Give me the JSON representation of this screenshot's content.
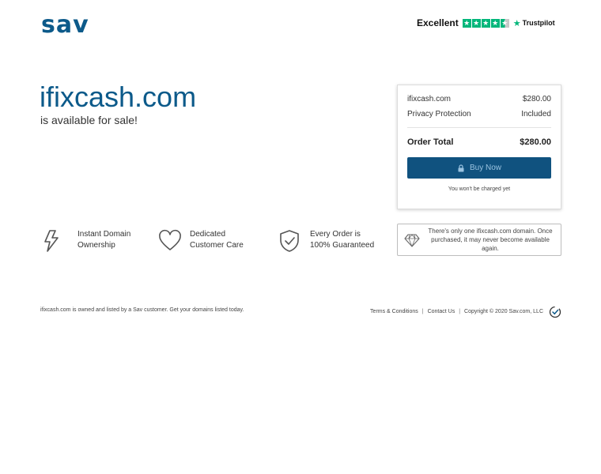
{
  "header": {
    "logo_text": "sav",
    "trust_label": "Excellent",
    "trust_brand": "Trustpilot",
    "trust_color": "#00b67a"
  },
  "hero": {
    "domain": "ifixcash.com",
    "availability": "is available for sale!"
  },
  "order": {
    "items": [
      {
        "label": "ifixcash.com",
        "value": "$280.00"
      },
      {
        "label": "Privacy Protection",
        "value": "Included"
      }
    ],
    "total_label": "Order Total",
    "total_value": "$280.00",
    "buy_label": "Buy Now",
    "note": "You won't be charged yet",
    "button_color": "#10527f"
  },
  "features": [
    {
      "icon": "lightning-icon",
      "line1": "Instant Domain",
      "line2": "Ownership"
    },
    {
      "icon": "heart-icon",
      "line1": "Dedicated",
      "line2": "Customer Care"
    },
    {
      "icon": "shield-check-icon",
      "line1": "Every Order is",
      "line2": "100% Guaranteed"
    }
  ],
  "unique_notice": {
    "line1": "There's only one ifixcash.com domain. Once",
    "line2": "purchased, it may never become available again."
  },
  "footer": {
    "left_text": "ifixcash.com is owned and listed by a Sav customer. Get your domains listed today.",
    "links": [
      "Terms & Conditions",
      "Contact Us"
    ],
    "copyright": "Copyright © 2020 Sav.com, LLC"
  },
  "colors": {
    "brand_blue": "#0c5a8a"
  }
}
